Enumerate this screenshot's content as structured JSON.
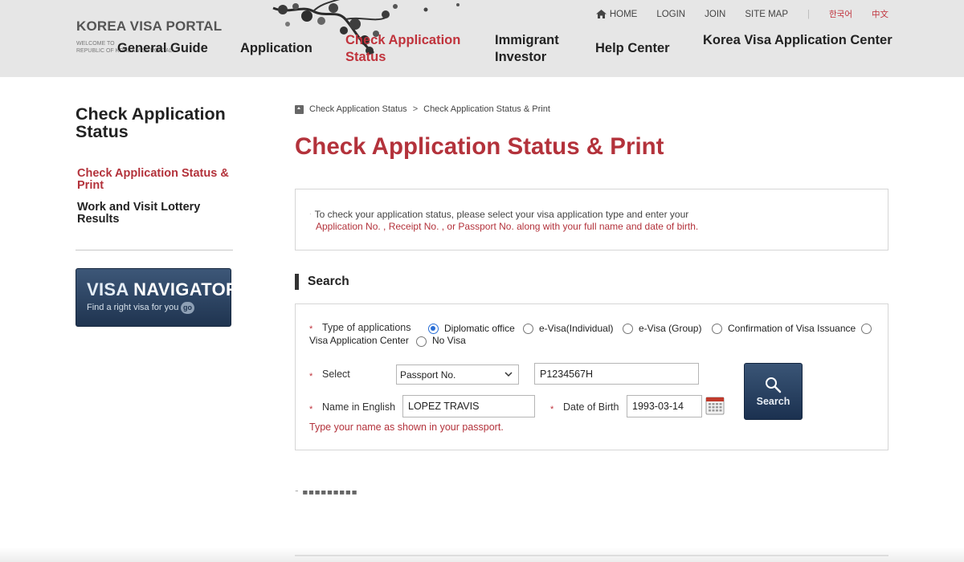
{
  "header": {
    "logo_title": "KOREA VISA PORTAL",
    "logo_subtitle": "WELCOME TO\nREPUBLIC OF KOREA VISA PORTAL",
    "utility": {
      "home": "HOME",
      "login": "LOGIN",
      "join": "JOIN",
      "sitemap": "SITE MAP",
      "separator": "|",
      "lang_korean": "한국어",
      "lang_chinese": "中文"
    },
    "nav": {
      "general_guide": "General Guide",
      "application": "Application",
      "check_status_line1": "Check Application",
      "check_status_line2": "Status",
      "immigrant_line1": "Immigrant",
      "immigrant_line2": "Investor",
      "help_center": "Help Center",
      "kvac": "Korea Visa Application Center"
    }
  },
  "sidebar": {
    "title": "Check Application Status",
    "items": [
      {
        "label": "Check Application Status & Print",
        "active": true
      },
      {
        "label": "Work and Visit Lottery Results",
        "active": false
      }
    ],
    "banner": {
      "title_part1": "VISA",
      "title_part2": "NAVIGATOR",
      "subtitle": "Find a right visa for you",
      "go": "go"
    }
  },
  "breadcrumb": {
    "items": [
      "Check Application Status",
      "Check Application Status & Print"
    ],
    "separator": ">"
  },
  "page_title": "Check Application Status & Print",
  "notice": {
    "bullet": "·",
    "line1": "To check your application status, please select your visa application type and enter your",
    "line2": "Application No. , Receipt No. , or Passport No. along with your full name and date of birth."
  },
  "search": {
    "section_title": "Search",
    "required_mark": "*",
    "type_label": "Type of applications",
    "types": [
      {
        "label": "Diplomatic office",
        "selected": true
      },
      {
        "label": "e-Visa(Individual)",
        "selected": false
      },
      {
        "label": "e-Visa (Group)",
        "selected": false
      },
      {
        "label": "Confirmation of Visa Issuance",
        "selected": false
      },
      {
        "label": "Visa Application Center",
        "selected": false
      },
      {
        "label": "No Visa",
        "selected": false
      }
    ],
    "select_label": "Select",
    "select_value": "Passport No.",
    "number_value": "P1234567H",
    "name_label": "Name in English",
    "name_value": "LOPEZ TRAVIS",
    "dob_label": "Date of Birth",
    "dob_value": "1993-03-14",
    "name_hint": "Type your name as shown in your passport.",
    "button_label": "Search"
  },
  "colors": {
    "accent_red": "#b3323b",
    "navy": "#1f3450",
    "header_bg": "#e6e6e6"
  }
}
